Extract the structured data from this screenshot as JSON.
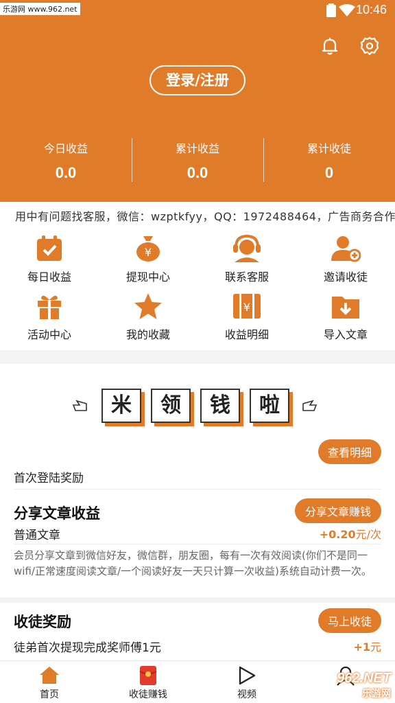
{
  "statusbar": {
    "watermark": "乐游网 www.962.net",
    "time": "10:46"
  },
  "header": {
    "login_label": "登录/注册",
    "stats": [
      {
        "label": "今日收益",
        "value": "0.0"
      },
      {
        "label": "累计收益",
        "value": "0.0"
      },
      {
        "label": "累计收徒",
        "value": "0"
      }
    ]
  },
  "notice": "用中有问题找客服，微信：wzptkfyy，QQ：1972488464，广告商务合作",
  "menu": [
    {
      "label": "每日收益",
      "icon": "calendar-check-icon"
    },
    {
      "label": "提现中心",
      "icon": "money-bag-icon"
    },
    {
      "label": "联系客服",
      "icon": "headset-icon"
    },
    {
      "label": "邀请收徒",
      "icon": "add-user-icon"
    },
    {
      "label": "活动中心",
      "icon": "gift-icon"
    },
    {
      "label": "我的收藏",
      "icon": "star-icon"
    },
    {
      "label": "收益明细",
      "icon": "ledger-icon"
    },
    {
      "label": "导入文章",
      "icon": "folder-download-icon"
    }
  ],
  "banner": {
    "chars": [
      "米",
      "领",
      "钱",
      "啦"
    ]
  },
  "rewards": {
    "detail_button": "查看明细",
    "first_login": "首次登陆奖励",
    "share": {
      "title": "分享文章收益",
      "button": "分享文章赚钱",
      "item": "普通文章",
      "amount": "+0.20",
      "unit": "元/次",
      "desc": "会员分享文章到微信好友，微信群，朋友圈，每有一次有效阅读(你们不是同一wifi/正常速度阅读文章/一个阅读好友一天只计算一次收益)系统自动计费一次。"
    },
    "recruit": {
      "title": "收徒奖励",
      "button": "马上收徒",
      "item": "徒弟首次提现完成奖师傅1元",
      "amount": "+1",
      "unit": "元"
    }
  },
  "tabbar": [
    {
      "label": "首页",
      "icon": "home-icon"
    },
    {
      "label": "收徒赚钱",
      "icon": "red-envelope-icon"
    },
    {
      "label": "视频",
      "icon": "play-icon"
    },
    {
      "label": "",
      "icon": "user-icon"
    }
  ],
  "watermark_bottom": {
    "brand": "962.NET",
    "sub": "乐游网"
  },
  "colors": {
    "accent": "#e07b2a",
    "background": "#f4f4f4"
  }
}
